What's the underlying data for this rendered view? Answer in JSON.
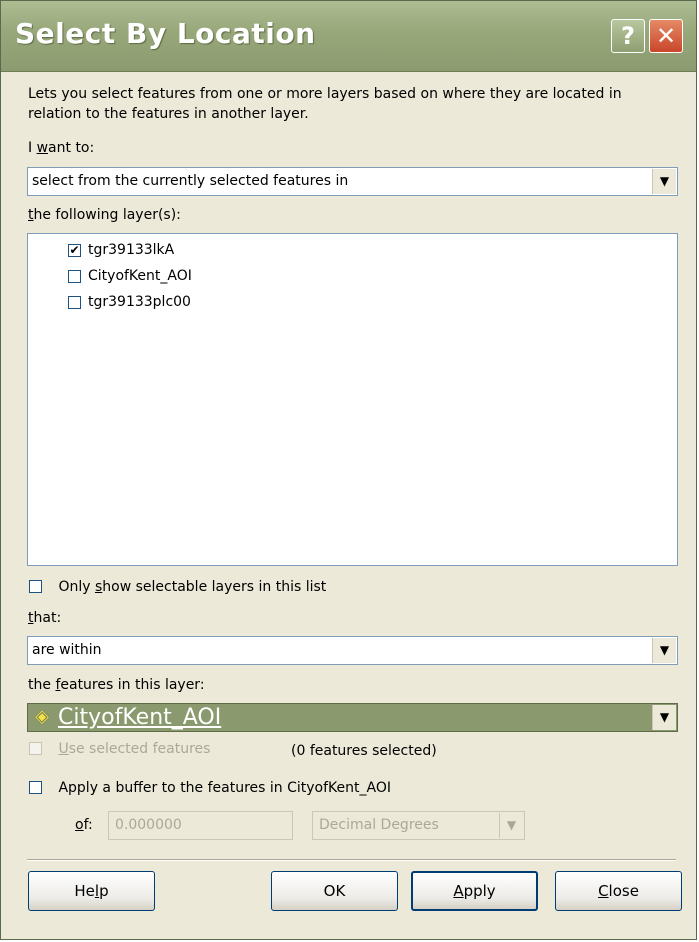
{
  "window": {
    "title": "Select By Location",
    "help_button": "?",
    "close_button": "✕"
  },
  "description": "Lets you select features from one or more layers based on where they are located in relation to the features in another layer.",
  "i_want_to": {
    "label_pre": "I ",
    "label_u": "w",
    "label_post": "ant to:",
    "value": "select from the currently selected features in"
  },
  "layers": {
    "label_pre": "",
    "label_u": "t",
    "label_post": "he following layer(s):",
    "items": [
      {
        "name": "tgr39133lkA",
        "checked": true,
        "mark": "✔"
      },
      {
        "name": "CityofKent_AOI",
        "checked": false,
        "mark": ""
      },
      {
        "name": "tgr39133plc00",
        "checked": false,
        "mark": ""
      }
    ]
  },
  "only_selectable": {
    "label_pre": "Only ",
    "label_u": "s",
    "label_post": "how selectable layers in this list"
  },
  "that": {
    "label_u": "t",
    "label_post": "hat:",
    "value": "are within"
  },
  "features_layer": {
    "label_pre": "the ",
    "label_u": "f",
    "label_post": "eatures in this layer:",
    "value": "CityofKent_AOI",
    "icon": "◈"
  },
  "use_selected": {
    "label_u": "U",
    "label_post": "se selected features",
    "count_text": "(0 features selected)"
  },
  "buffer": {
    "label": "Apply a buffer to the features in CityofKent_AOI",
    "of_u": "o",
    "of_post": "f:",
    "distance": "0.000000",
    "units": "Decimal Degrees"
  },
  "buttons": {
    "help_pre": "He",
    "help_u": "l",
    "help_post": "p",
    "ok": "OK",
    "apply_u": "A",
    "apply_post": "pply",
    "close_u": "C",
    "close_post": "lose"
  },
  "arrow_glyph": "▼"
}
